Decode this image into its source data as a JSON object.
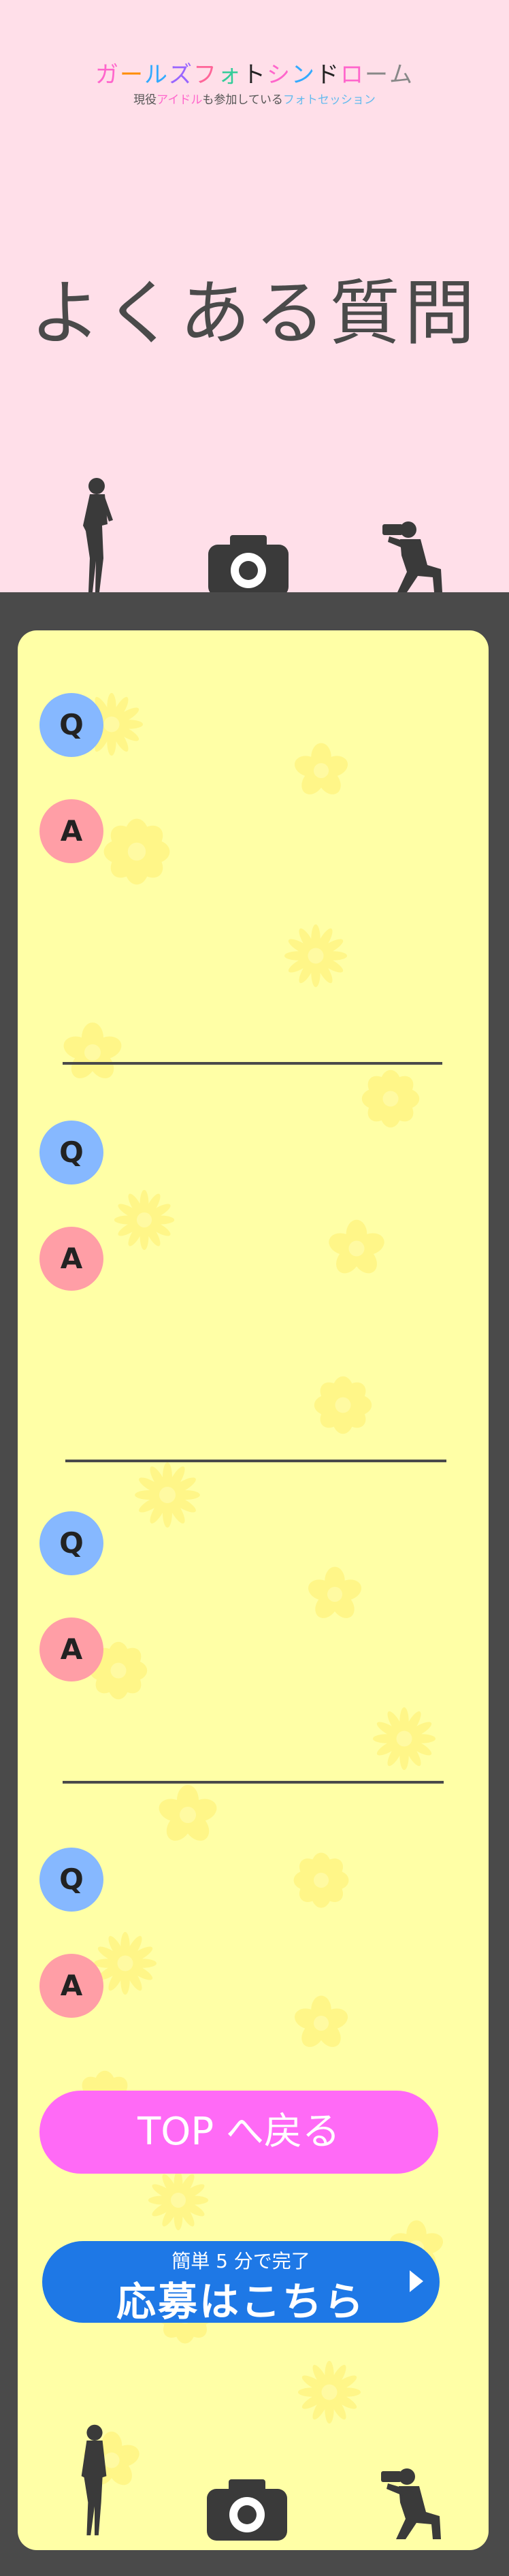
{
  "site": {
    "logo_chars": [
      "ガ",
      "ー",
      "ル",
      "ズ",
      "フ",
      "ォ",
      "ト",
      "シ",
      "ン",
      "ド",
      "ロ",
      "ー",
      "ム"
    ],
    "logo_colors": [
      "#ff66cc",
      "#ff8c00",
      "#33aaff",
      "#9966ff",
      "#ff6699",
      "#33cc99",
      "#222222",
      "#ff66cc",
      "#33aaff",
      "#222222",
      "#ff66cc",
      "#888888",
      "#888888"
    ],
    "subtitle_parts": [
      "現役",
      "アイドル",
      "も参加している",
      "フォトセッション"
    ],
    "subtitle_colors": [
      "#555555",
      "#ff66cc",
      "#555555",
      "#66bbee"
    ]
  },
  "page": {
    "title": "よくある質問"
  },
  "faq": {
    "q_label": "Q",
    "a_label": "A",
    "items": [
      {
        "question": "",
        "answer": ""
      },
      {
        "question": "",
        "answer": ""
      },
      {
        "question": "",
        "answer": ""
      },
      {
        "question": "",
        "answer": ""
      }
    ]
  },
  "buttons": {
    "top_label": "TOP へ戻る",
    "apply_sub": "簡単 5 分で完了",
    "apply_main": "応募はこちら"
  },
  "colors": {
    "header_bg": "#ffdfe9",
    "band_bg": "#4a4a4a",
    "panel_bg": "#ffffa6",
    "q_badge": "#86b8ff",
    "a_badge": "#ff9ea6",
    "top_button": "#ff6af6",
    "apply_button": "#1e78e6",
    "flower": "#fff070"
  },
  "icons": [
    "camera-icon",
    "model-silhouette",
    "photographer-silhouette",
    "flower-decoration",
    "arrow-right-icon"
  ]
}
